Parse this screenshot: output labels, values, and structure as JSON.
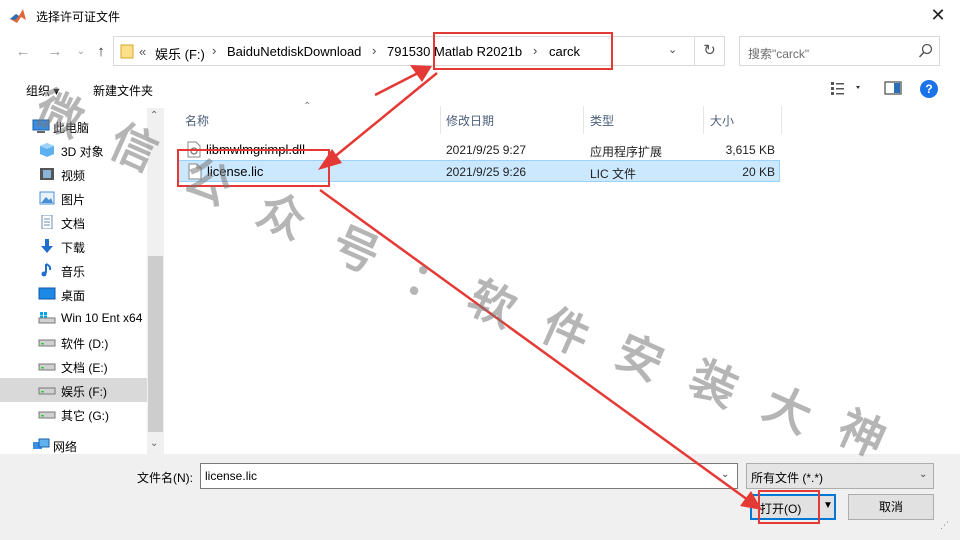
{
  "window": {
    "title": "选择许可证文件",
    "close_glyph": "✕"
  },
  "nav": {
    "breadcrumbs": [
      "«",
      "娱乐 (F:)",
      "BaiduNetdiskDownload",
      "791530 Matlab R2021b",
      "carck"
    ],
    "separator": "›",
    "search_placeholder": "搜索\"carck\""
  },
  "toolbar": {
    "organize": "组织 ▾",
    "new_folder": "新建文件夹"
  },
  "sidebar": {
    "items": [
      {
        "label": "此电脑",
        "icon": "computer-icon"
      },
      {
        "label": "3D 对象",
        "icon": "cube-icon"
      },
      {
        "label": "视频",
        "icon": "video-icon"
      },
      {
        "label": "图片",
        "icon": "picture-icon"
      },
      {
        "label": "文档",
        "icon": "document-icon"
      },
      {
        "label": "下载",
        "icon": "download-icon"
      },
      {
        "label": "音乐",
        "icon": "music-icon"
      },
      {
        "label": "桌面",
        "icon": "desktop-icon"
      },
      {
        "label": "Win 10 Ent x64",
        "icon": "drive-icon"
      },
      {
        "label": "软件 (D:)",
        "icon": "drive-icon"
      },
      {
        "label": "文档 (E:)",
        "icon": "drive-icon"
      },
      {
        "label": "娱乐 (F:)",
        "icon": "drive-icon",
        "selected": true
      },
      {
        "label": "其它 (G:)",
        "icon": "drive-icon"
      },
      {
        "label": "网络",
        "icon": "network-icon"
      }
    ]
  },
  "columns": {
    "name": "名称",
    "date": "修改日期",
    "type": "类型",
    "size": "大小"
  },
  "files": [
    {
      "name": "libmwlmgrimpl.dll",
      "date": "2021/9/25 9:27",
      "type": "应用程序扩展",
      "size": "3,615 KB",
      "icon": "dll-file-icon"
    },
    {
      "name": "license.lic",
      "date": "2021/9/25 9:26",
      "type": "LIC 文件",
      "size": "20 KB",
      "icon": "blank-file-icon",
      "selected": true
    }
  ],
  "footer": {
    "filename_label": "文件名(N):",
    "filename_value": "license.lic",
    "filetype_value": "所有文件 (*.*)",
    "open_label": "打开(O)",
    "cancel_label": "取消"
  },
  "watermark": [
    "微",
    "信",
    "公",
    "众",
    "号",
    "：",
    "软",
    "件",
    "安",
    "装",
    "大",
    "神"
  ],
  "colors": {
    "selection_bg": "#cce8ff",
    "selection_border": "#99d1ff",
    "accent": "#0078d7",
    "annotation": "#e53935"
  }
}
